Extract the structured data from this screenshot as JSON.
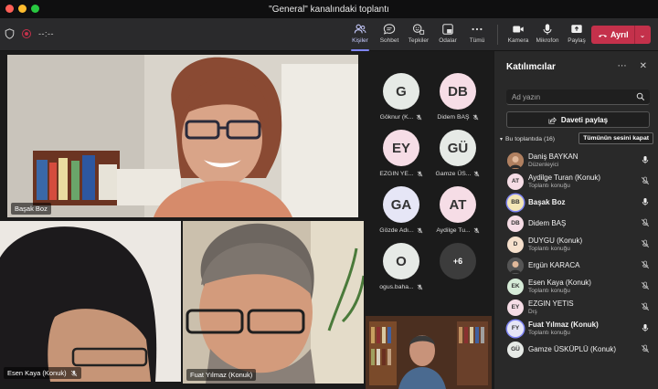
{
  "window": {
    "title": "\"General\" kanalındaki toplantı",
    "traffic_colors": [
      "#ff5f57",
      "#febc2e",
      "#28c840"
    ]
  },
  "toolbar": {
    "timer": "--:--",
    "items": [
      {
        "label": "Kişiler",
        "icon": "people-icon",
        "active": true
      },
      {
        "label": "Sohbet",
        "icon": "chat-icon"
      },
      {
        "label": "Tepkiler",
        "icon": "reactions-icon"
      },
      {
        "label": "Odalar",
        "icon": "rooms-icon"
      },
      {
        "label": "Tümü",
        "icon": "more-icon"
      },
      {
        "label": "Kamera",
        "icon": "camera-icon"
      },
      {
        "label": "Mikrofon",
        "icon": "microphone-icon"
      },
      {
        "label": "Paylaş",
        "icon": "share-icon"
      }
    ],
    "leave_label": "Ayrıl",
    "accent": "#7f85f5",
    "leave_color": "#c4314b"
  },
  "stage": {
    "tiles": [
      {
        "name": "Başak Boz"
      },
      {
        "name": "Esen Kaya (Konuk)"
      },
      {
        "name": "Fuat Yılmaz (Konuk)"
      },
      {
        "name": ""
      }
    ],
    "grid": [
      {
        "initials": "G",
        "name": "Göknur (K...",
        "color": "#e6eae6"
      },
      {
        "initials": "DB",
        "name": "Didem BAŞ",
        "color": "#f6dde6"
      },
      {
        "initials": "EY",
        "name": "EZGIN YE...",
        "color": "#f6dde6"
      },
      {
        "initials": "GÜ",
        "name": "Gamze ÜS...",
        "color": "#e6eae6"
      },
      {
        "initials": "GA",
        "name": "Gözde Adı...",
        "color": "#e6e6f6"
      },
      {
        "initials": "AT",
        "name": "Aydilge Tu...",
        "color": "#f6dde6"
      },
      {
        "initials": "O",
        "name": "ogus.baha...",
        "color": "#e6eae6"
      }
    ],
    "overflow": "+6"
  },
  "panel": {
    "title": "Katılımcılar",
    "search_placeholder": "Ad yazın",
    "share_invite": "Daveti paylaş",
    "section": "Bu toplantıda (16)",
    "mute_all": "Tümünün sesini kapat",
    "participants": [
      {
        "initials": "",
        "name": "Daniş BAYKAN",
        "sub": "Düzenleyici",
        "photo": true,
        "mic": "on",
        "color": "#b08060"
      },
      {
        "initials": "AT",
        "name": "Aydilge Turan (Konuk)",
        "sub": "Toplantı konuğu",
        "mic": "off",
        "color": "#f6dde6"
      },
      {
        "initials": "BB",
        "name": "Başak Boz",
        "sub": "",
        "bold": true,
        "ring": true,
        "mic": "on",
        "color": "#f3e6b6"
      },
      {
        "initials": "DB",
        "name": "Didem BAŞ",
        "sub": "",
        "mic": "off",
        "color": "#f6dde6"
      },
      {
        "initials": "D",
        "name": "DUYGU (Konuk)",
        "sub": "Toplantı konuğu",
        "mic": "off",
        "color": "#f6e0cc"
      },
      {
        "initials": "",
        "name": "Ergün KARACA",
        "sub": "",
        "photo": true,
        "mic": "off",
        "color": "#555555"
      },
      {
        "initials": "EK",
        "name": "Esen Kaya (Konuk)",
        "sub": "Toplantı konuğu",
        "mic": "off",
        "color": "#d6ecd8"
      },
      {
        "initials": "EY",
        "name": "EZGIN YETIS",
        "sub": "Dış",
        "mic": "off",
        "color": "#f6dde6"
      },
      {
        "initials": "FY",
        "name": "Fuat Yılmaz (Konuk)",
        "sub": "Toplantı konuğu",
        "bold": true,
        "ring": true,
        "mic": "on",
        "color": "#e6e6f6"
      },
      {
        "initials": "GÜ",
        "name": "Gamze ÜSKÜPLÜ (Konuk)",
        "sub": "",
        "mic": "off",
        "color": "#e6eae6"
      }
    ]
  }
}
